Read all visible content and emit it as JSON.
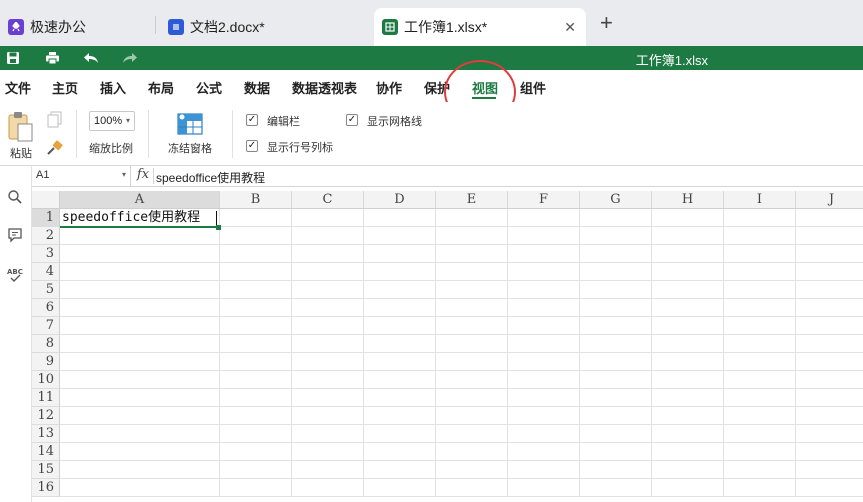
{
  "tabs": [
    {
      "label": "极速办公",
      "icon": "rocket-icon",
      "color": "#6a3fd1"
    },
    {
      "label": "文档2.docx*",
      "icon": "document-icon",
      "color": "#2d5ad8"
    },
    {
      "label": "工作簿1.xlsx*",
      "icon": "spreadsheet-icon",
      "color": "#1e7a43",
      "active": true
    }
  ],
  "titlebar": {
    "doc_title": "工作簿1.xlsx"
  },
  "menu": [
    "文件",
    "主页",
    "插入",
    "布局",
    "公式",
    "数据",
    "数据透视表",
    "协作",
    "保护",
    "视图",
    "组件"
  ],
  "menu_active": "视图",
  "ribbon": {
    "paste_label": "粘贴",
    "zoom_value": "100%",
    "zoom_label": "缩放比例",
    "freeze_label": "冻结窗格",
    "formula_bar_label": "编辑栏",
    "headings_label": "显示行号列标",
    "gridlines_label": "显示网格线"
  },
  "formula": {
    "name_box": "A1",
    "fx": "fx",
    "value": "speedoffice使用教程"
  },
  "columns": [
    "A",
    "B",
    "C",
    "D",
    "E",
    "F",
    "G",
    "H",
    "I",
    "J"
  ],
  "rows": [
    "1",
    "2",
    "3",
    "4",
    "5",
    "6",
    "7",
    "8",
    "9",
    "10",
    "11",
    "12",
    "13",
    "14",
    "15",
    "16"
  ],
  "cell_a1": "speedoffice使用教程",
  "colors": {
    "accent": "#1e7a43",
    "highlight_circle": "#e23b3b"
  }
}
